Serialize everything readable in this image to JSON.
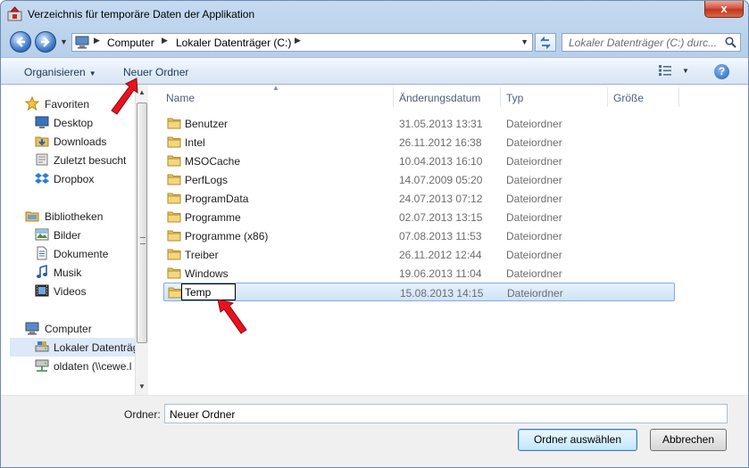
{
  "window": {
    "title": "Verzeichnis für temporäre Daten der Applikation",
    "close_glyph": "x"
  },
  "address": {
    "crumbs": [
      "Computer",
      "Lokaler Datenträger (C:)"
    ],
    "search_placeholder": "Lokaler Datenträger (C:) durc..."
  },
  "toolbar": {
    "organize_label": "Organisieren",
    "new_folder_label": "Neuer Ordner",
    "help_glyph": "?"
  },
  "nav": {
    "favorites": {
      "header": "Favoriten",
      "items": [
        "Desktop",
        "Downloads",
        "Zuletzt besucht",
        "Dropbox"
      ]
    },
    "libraries": {
      "header": "Bibliotheken",
      "items": [
        "Bilder",
        "Dokumente",
        "Musik",
        "Videos"
      ]
    },
    "computer": {
      "header": "Computer",
      "items": [
        "Lokaler Datenträger",
        "oldaten (\\\\cewe.l"
      ]
    }
  },
  "columns": {
    "name": "Name",
    "date": "Änderungsdatum",
    "type": "Typ",
    "size": "Größe"
  },
  "files": [
    {
      "name": "Benutzer",
      "date": "31.05.2013 13:31",
      "type": "Dateiordner"
    },
    {
      "name": "Intel",
      "date": "26.11.2012 16:38",
      "type": "Dateiordner"
    },
    {
      "name": "MSOCache",
      "date": "10.04.2013 16:10",
      "type": "Dateiordner"
    },
    {
      "name": "PerfLogs",
      "date": "14.07.2009 05:20",
      "type": "Dateiordner"
    },
    {
      "name": "ProgramData",
      "date": "24.07.2013 07:12",
      "type": "Dateiordner"
    },
    {
      "name": "Programme",
      "date": "02.07.2013 13:15",
      "type": "Dateiordner"
    },
    {
      "name": "Programme (x86)",
      "date": "07.08.2013 11:53",
      "type": "Dateiordner"
    },
    {
      "name": "Treiber",
      "date": "26.11.2012 12:44",
      "type": "Dateiordner"
    },
    {
      "name": "Windows",
      "date": "19.06.2013 11:04",
      "type": "Dateiordner"
    },
    {
      "name": "Temp",
      "date": "15.08.2013 14:15",
      "type": "Dateiordner"
    }
  ],
  "bottom": {
    "folder_label": "Ordner:",
    "folder_value": "Neuer Ordner",
    "select_button": "Ordner auswählen",
    "cancel_button": "Abbrechen"
  },
  "colors": {
    "accent": "#3399ff",
    "annotation_arrow": "#e8121e"
  }
}
